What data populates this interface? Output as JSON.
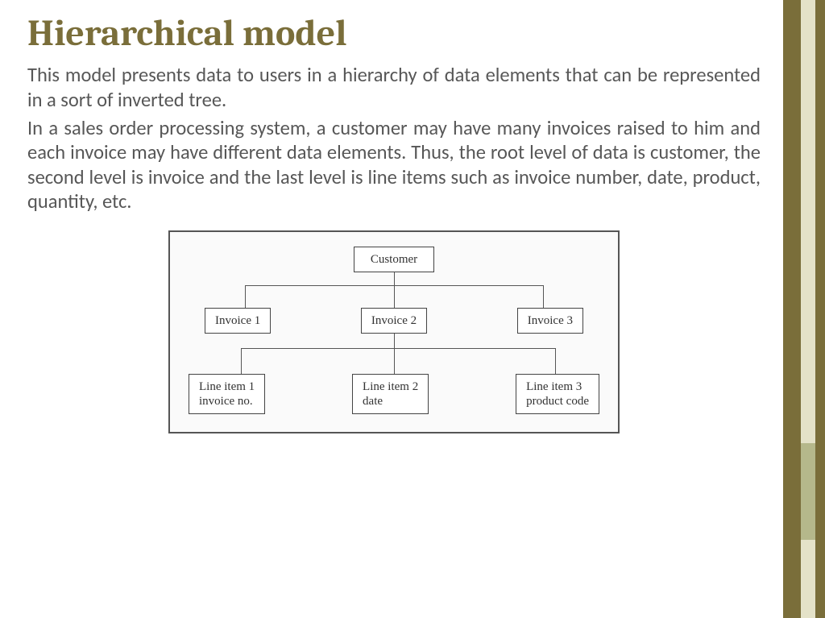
{
  "title": "Hierarchical model",
  "paragraphs": {
    "p1": "This model presents data to users in a hierarchy of data elements that can be represented in a sort of inverted tree.",
    "p2": "In a sales order processing system, a customer may have many invoices raised to him and each invoice may have different data elements. Thus, the root level of data is customer, the second level is invoice and the last level is line items such as invoice number, date, product, quantity, etc."
  },
  "diagram": {
    "root": "Customer",
    "level2": [
      "Invoice 1",
      "Invoice 2",
      "Invoice 3"
    ],
    "level3": [
      "Line item 1\ninvoice no.",
      "Line item 2\ndate",
      "Line item 3\nproduct code"
    ]
  },
  "colors": {
    "title": "#7a6e3a",
    "sidebar_dark": "#7a6e3a",
    "sidebar_light": "#e4e2c8",
    "sidebar_accent": "#b5b88b"
  }
}
